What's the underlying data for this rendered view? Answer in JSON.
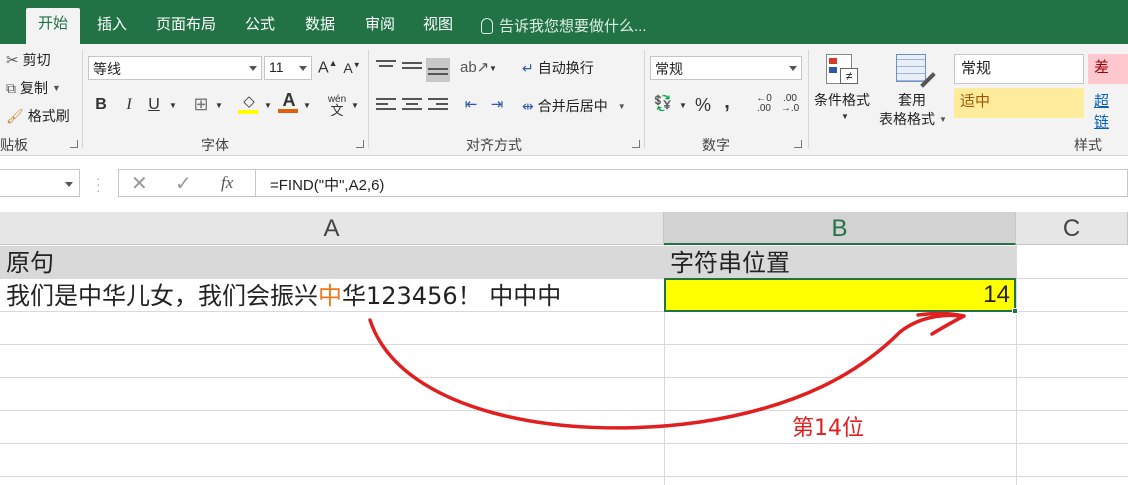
{
  "ribbon_tabs": [
    "开始",
    "插入",
    "页面布局",
    "公式",
    "数据",
    "审阅",
    "视图"
  ],
  "tell_me": "告诉我您想要做什么...",
  "clipboard": {
    "cut": "剪切",
    "copy": "复制",
    "format_painter": "格式刷",
    "group_label": "贴板"
  },
  "font": {
    "name": "等线",
    "size": "11",
    "grow": "A",
    "shrink": "A",
    "bold": "B",
    "italic": "I",
    "underline": "U",
    "phonetic": "wén",
    "phonetic_char": "文",
    "group_label": "字体"
  },
  "alignment": {
    "wrap_text": "自动换行",
    "merge_center": "合并后居中",
    "group_label": "对齐方式"
  },
  "number": {
    "format": "常规",
    "percent": "%",
    "comma": ",",
    "group_label": "数字"
  },
  "styles": {
    "conditional_format": "条件格式",
    "format_as_table_1": "套用",
    "format_as_table_2": "表格格式",
    "normal": "常规",
    "bad": "差",
    "neutral": "适中",
    "hyperlink": "超链",
    "group_label": "样式"
  },
  "formula_bar": {
    "fx": "fx",
    "formula": "=FIND(\"中\",A2,6)"
  },
  "columns": [
    "A",
    "B",
    "C"
  ],
  "cells": {
    "a1": "原句",
    "b1": "字符串位置",
    "a2_before": "我们是中华儿女，我们会振兴",
    "a2_highlight": "中",
    "a2_after": "华123456！ 中中中",
    "b2": "14"
  },
  "annotation": "第14位",
  "colors": {
    "excel_green": "#217346",
    "highlight_yellow": "#ffff00",
    "annotation_red": "#e02020",
    "char_orange": "#f07820"
  }
}
